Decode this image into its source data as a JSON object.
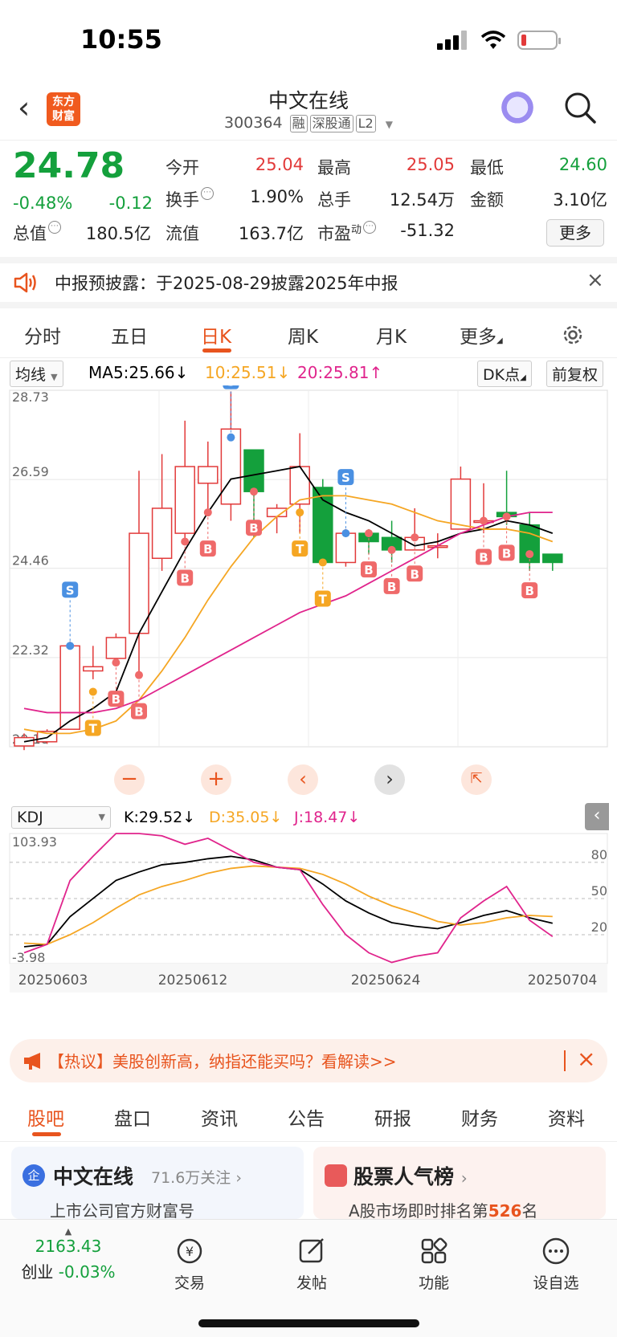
{
  "status": {
    "time": "10:55"
  },
  "header": {
    "logo_line1": "东方",
    "logo_line2": "财富",
    "stock_name": "中文在线",
    "stock_code": "300364",
    "tags": [
      "融",
      "深股通",
      "L2"
    ]
  },
  "quote": {
    "price": "24.78",
    "change_pct": "-0.48%",
    "change": "-0.12",
    "open_label": "今开",
    "open": "25.04",
    "high_label": "最高",
    "high": "25.05",
    "low_label": "最低",
    "low": "24.60",
    "turnover_label": "换手",
    "turnover": "1.90%",
    "volume_label": "总手",
    "volume": "12.54万",
    "amount_label": "金额",
    "amount": "3.10亿",
    "mktcap_label": "总值",
    "mktcap": "180.5亿",
    "float_label": "流值",
    "float": "163.7亿",
    "pe_label": "市盈",
    "pe_sup": "动",
    "pe": "-51.32",
    "more": "更多"
  },
  "notice": {
    "text": "中报预披露：于2025-08-29披露2025年中报"
  },
  "chart_tabs": [
    "分时",
    "五日",
    "日K",
    "周K",
    "月K",
    "更多"
  ],
  "ma_row": {
    "type": "均线",
    "ma5": "MA5:25.66",
    "ma10": "10:25.51",
    "ma20": "20:25.81",
    "dk": "DK点",
    "adjust": "前复权"
  },
  "kdj_row": {
    "type": "KDJ",
    "k": "K:29.52",
    "d": "D:35.05",
    "j": "J:18.47"
  },
  "colors": {
    "up": "#e23a3a",
    "down": "#14a03c",
    "ma5": "#000000",
    "ma10": "#f5a623",
    "ma20": "#e0248c",
    "accent": "#e8541e",
    "buy_marker": "#ef6a6a",
    "sell_marker": "#4a90e2",
    "t_marker": "#f5a623"
  },
  "chart_data": [
    {
      "type": "candlestick",
      "y_ticks": [
        "28.73",
        "26.59",
        "24.46",
        "22.32",
        "20.18"
      ],
      "ylim": [
        20.18,
        28.73
      ],
      "x_ticks": [
        "20250603",
        "20250612",
        "20250624",
        "20250704"
      ],
      "candles": [
        [
          20.2,
          20.4,
          20.1,
          20.5
        ],
        [
          20.3,
          20.55,
          20.25,
          20.6
        ],
        [
          20.6,
          22.6,
          20.6,
          22.7
        ],
        [
          22.0,
          22.1,
          21.8,
          22.6
        ],
        [
          22.3,
          22.8,
          22.2,
          22.9
        ],
        [
          22.9,
          25.3,
          21.9,
          26.8
        ],
        [
          24.7,
          25.9,
          24.4,
          27.2
        ],
        [
          25.3,
          26.9,
          25.1,
          28.0
        ],
        [
          26.5,
          26.9,
          25.8,
          27.5
        ],
        [
          26.0,
          27.8,
          25.6,
          28.7
        ],
        [
          27.3,
          26.3,
          25.2,
          27.3
        ],
        [
          25.7,
          25.9,
          25.3,
          26.0
        ],
        [
          26.0,
          26.9,
          25.3,
          27.7
        ],
        [
          26.4,
          24.6,
          24.6,
          26.6
        ],
        [
          24.6,
          25.3,
          24.5,
          25.4
        ],
        [
          25.3,
          25.1,
          24.8,
          25.4
        ],
        [
          25.2,
          24.9,
          24.6,
          25.6
        ],
        [
          24.9,
          25.2,
          24.9,
          25.9
        ],
        [
          25.0,
          25.0,
          24.7,
          25.3
        ],
        [
          25.4,
          26.6,
          25.4,
          26.9
        ],
        [
          25.6,
          25.6,
          25.3,
          26.5
        ],
        [
          25.8,
          25.7,
          25.5,
          26.8
        ],
        [
          25.5,
          24.6,
          24.4,
          25.8
        ],
        [
          24.8,
          24.6,
          24.4,
          24.8
        ]
      ],
      "ma5": [
        20.3,
        20.4,
        20.8,
        21.1,
        21.5,
        22.9,
        23.9,
        24.9,
        25.8,
        26.6,
        26.7,
        26.8,
        26.9,
        26.1,
        25.8,
        25.6,
        25.3,
        25.0,
        25.1,
        25.3,
        25.4,
        25.6,
        25.5,
        25.3
      ],
      "ma10": [
        20.6,
        20.5,
        20.5,
        20.6,
        20.8,
        21.3,
        22.0,
        22.8,
        23.7,
        24.5,
        25.2,
        25.7,
        26.1,
        26.2,
        26.2,
        26.1,
        26.0,
        25.8,
        25.6,
        25.5,
        25.4,
        25.4,
        25.3,
        25.1
      ],
      "ma20": [
        21.1,
        21.0,
        21.0,
        21.0,
        21.1,
        21.3,
        21.6,
        21.9,
        22.2,
        22.5,
        22.8,
        23.1,
        23.4,
        23.6,
        23.8,
        24.1,
        24.4,
        24.7,
        25.0,
        25.3,
        25.5,
        25.7,
        25.8,
        25.8
      ],
      "markers": [
        {
          "i": 2,
          "type": "S",
          "price": 22.6
        },
        {
          "i": 3,
          "type": "T",
          "price": 21.5
        },
        {
          "i": 4,
          "type": "B",
          "price": 22.2
        },
        {
          "i": 5,
          "type": "B",
          "price": 21.9
        },
        {
          "i": 7,
          "type": "B",
          "price": 25.1
        },
        {
          "i": 8,
          "type": "B",
          "price": 25.8
        },
        {
          "i": 9,
          "type": "S",
          "price": 27.6
        },
        {
          "i": 10,
          "type": "B",
          "price": 26.3
        },
        {
          "i": 12,
          "type": "T",
          "price": 25.8
        },
        {
          "i": 13,
          "type": "T",
          "price": 24.6
        },
        {
          "i": 14,
          "type": "S",
          "price": 25.3
        },
        {
          "i": 15,
          "type": "B",
          "price": 25.3
        },
        {
          "i": 16,
          "type": "B",
          "price": 24.9
        },
        {
          "i": 17,
          "type": "B",
          "price": 25.2
        },
        {
          "i": 20,
          "type": "B",
          "price": 25.6
        },
        {
          "i": 21,
          "type": "B",
          "price": 25.7
        },
        {
          "i": 22,
          "type": "B",
          "price": 24.8
        }
      ]
    },
    {
      "type": "line",
      "y_ticks": [
        "103.93",
        "-3.98"
      ],
      "ylim": [
        -3.98,
        103.93
      ],
      "ref_lines": [
        80,
        50,
        20
      ],
      "K": [
        10,
        12,
        35,
        50,
        65,
        72,
        78,
        80,
        83,
        85,
        82,
        76,
        74,
        62,
        48,
        38,
        30,
        27,
        25,
        30,
        36,
        40,
        34,
        29.52
      ],
      "D": [
        13,
        12,
        20,
        30,
        42,
        53,
        60,
        65,
        71,
        75,
        77,
        76,
        75,
        70,
        62,
        52,
        44,
        38,
        31,
        28,
        30,
        34,
        36,
        35.05
      ],
      "J": [
        5,
        12,
        65,
        85,
        105,
        104,
        102,
        95,
        100,
        90,
        80,
        76,
        74,
        45,
        20,
        5,
        -3,
        2,
        5,
        34,
        48,
        60,
        32,
        18.47
      ]
    }
  ],
  "hot_banner": {
    "text": "【热议】美股创新高，纳指还能买吗？看解读>>"
  },
  "bottom_tabs": [
    "股吧",
    "盘口",
    "资讯",
    "公告",
    "研报",
    "财务",
    "资料"
  ],
  "cards": {
    "left_title": "中文在线",
    "left_follow": "71.6万关注",
    "left_sub": "上市公司官方财富号",
    "right_title": "股票人气榜",
    "right_sub_pre": "A股市场即时排名第",
    "right_rank": "526",
    "right_sub_post": "名"
  },
  "toolbar": {
    "index_value": "2163.43",
    "index_name": "创业",
    "index_change": "-0.03%",
    "items": [
      "交易",
      "发帖",
      "功能",
      "设自选"
    ]
  }
}
